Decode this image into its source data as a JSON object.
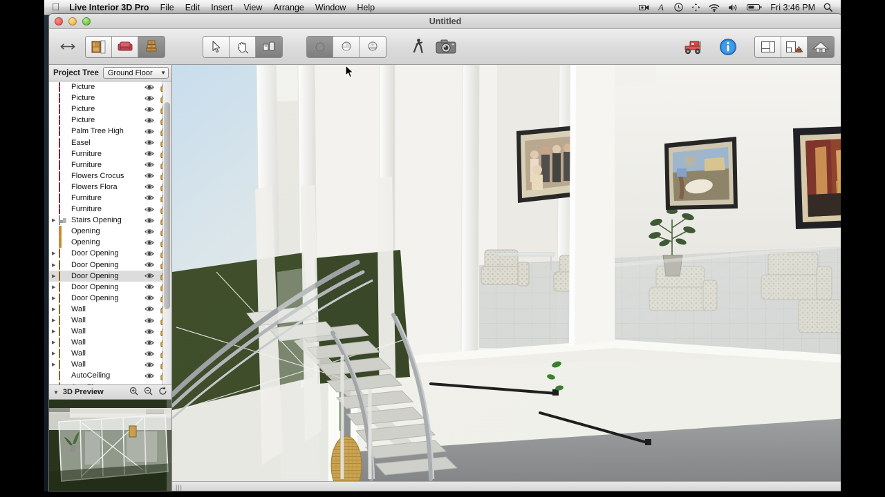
{
  "menubar": {
    "apple_icon": "apple-logo",
    "app_name": "Live Interior 3D Pro",
    "menus": [
      "File",
      "Edit",
      "Insert",
      "View",
      "Arrange",
      "Window",
      "Help"
    ],
    "status_icons": [
      "screen-record-icon",
      "text-input-icon",
      "time-machine-icon",
      "displays-icon",
      "wifi-icon",
      "volume-icon",
      "battery-icon"
    ],
    "clock": "Fri 3:46 PM",
    "search_icon": "spotlight-search-icon"
  },
  "window": {
    "title": "Untitled",
    "close_label": "close",
    "minimize_label": "minimize",
    "zoom_label": "zoom"
  },
  "toolbar": {
    "back_forward": "navigate-arrows",
    "library_buttons": [
      {
        "name": "materials-library",
        "selected": false
      },
      {
        "name": "furniture-library",
        "selected": false
      },
      {
        "name": "objects-library",
        "selected": true
      }
    ],
    "tool_buttons": [
      {
        "name": "select-tool",
        "selected": false
      },
      {
        "name": "pan-tool",
        "selected": false
      },
      {
        "name": "measure-tool",
        "selected": true
      }
    ],
    "render_buttons": [
      {
        "name": "solid-render",
        "selected": true
      },
      {
        "name": "shaded-render",
        "selected": false
      },
      {
        "name": "outline-render",
        "selected": false
      }
    ],
    "walkthrough_label": "walk-through",
    "camera_label": "snapshot-camera",
    "truck_label": "move-object",
    "info_label": "inspector-info",
    "view_modes": [
      {
        "name": "floor-plan-view",
        "selected": false
      },
      {
        "name": "split-view",
        "selected": false
      },
      {
        "name": "3d-view",
        "selected": true
      }
    ]
  },
  "sidebar": {
    "title": "Project Tree",
    "floor": "Ground Floor",
    "items": [
      {
        "label": "Picture",
        "icon": "furniture",
        "expandable": false,
        "selected": false
      },
      {
        "label": "Picture",
        "icon": "furniture",
        "expandable": false,
        "selected": false
      },
      {
        "label": "Picture",
        "icon": "furniture",
        "expandable": false,
        "selected": false
      },
      {
        "label": "Picture",
        "icon": "furniture",
        "expandable": false,
        "selected": false
      },
      {
        "label": "Palm Tree High",
        "icon": "furniture",
        "expandable": false,
        "selected": false
      },
      {
        "label": "Easel",
        "icon": "furniture",
        "expandable": false,
        "selected": false
      },
      {
        "label": "Furniture",
        "icon": "furniture",
        "expandable": false,
        "selected": false
      },
      {
        "label": "Furniture",
        "icon": "furniture",
        "expandable": false,
        "selected": false
      },
      {
        "label": "Flowers Crocus",
        "icon": "furniture",
        "expandable": false,
        "selected": false
      },
      {
        "label": "Flowers Flora",
        "icon": "furniture",
        "expandable": false,
        "selected": false
      },
      {
        "label": "Furniture",
        "icon": "furniture",
        "expandable": false,
        "selected": false
      },
      {
        "label": "Furniture",
        "icon": "furniture",
        "expandable": false,
        "selected": false
      },
      {
        "label": "Stairs Opening",
        "icon": "stairs",
        "expandable": true,
        "selected": false
      },
      {
        "label": "Opening",
        "icon": "opening",
        "expandable": false,
        "selected": false
      },
      {
        "label": "Opening",
        "icon": "opening",
        "expandable": false,
        "selected": false
      },
      {
        "label": "Door Opening",
        "icon": "door",
        "expandable": true,
        "selected": false
      },
      {
        "label": "Door Opening",
        "icon": "door",
        "expandable": true,
        "selected": false
      },
      {
        "label": "Door Opening",
        "icon": "door",
        "expandable": true,
        "selected": true
      },
      {
        "label": "Door Opening",
        "icon": "door",
        "expandable": true,
        "selected": false
      },
      {
        "label": "Door Opening",
        "icon": "door",
        "expandable": true,
        "selected": false
      },
      {
        "label": "Wall",
        "icon": "wall",
        "expandable": true,
        "selected": false
      },
      {
        "label": "Wall",
        "icon": "wall",
        "expandable": true,
        "selected": false
      },
      {
        "label": "Wall",
        "icon": "wall",
        "expandable": true,
        "selected": false
      },
      {
        "label": "Wall",
        "icon": "wall",
        "expandable": true,
        "selected": false
      },
      {
        "label": "Wall",
        "icon": "wall",
        "expandable": true,
        "selected": false
      },
      {
        "label": "Wall",
        "icon": "wall",
        "expandable": true,
        "selected": false
      },
      {
        "label": "AutoCeiling",
        "icon": "auto",
        "expandable": false,
        "selected": false
      },
      {
        "label": "AutoFloor",
        "icon": "auto",
        "expandable": false,
        "selected": false
      }
    ],
    "visibility_icon": "eye-icon",
    "lock_icon": "unlocked-padlock-icon"
  },
  "preview": {
    "title": "3D Preview",
    "zoom_in_icon": "zoom-in-icon",
    "zoom_out_icon": "zoom-out-icon",
    "rotate_icon": "rotate-icon"
  },
  "viewport": {
    "name": "3d-viewport",
    "resize_grip": "|||",
    "scene_description": "Interior 3D rendering of a modern glass-walled living space with floating staircase"
  },
  "colors": {
    "wall_white": "#f0efe9",
    "accent_green": "#35441f",
    "floor_gray": "#8b8d8f",
    "sky_blue": "#bcd2e0",
    "handrail_black": "#1a1a1a"
  }
}
